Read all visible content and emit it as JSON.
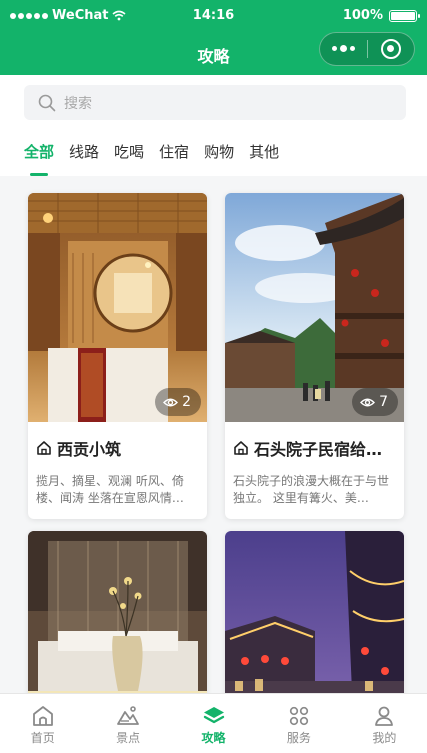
{
  "status_bar": {
    "carrier": "WeChat",
    "time": "14:16",
    "battery": "100%"
  },
  "header": {
    "title": "攻略"
  },
  "search": {
    "placeholder": "搜索"
  },
  "tabs": [
    {
      "label": "全部",
      "active": true
    },
    {
      "label": "线路",
      "active": false
    },
    {
      "label": "吃喝",
      "active": false
    },
    {
      "label": "住宿",
      "active": false
    },
    {
      "label": "购物",
      "active": false
    },
    {
      "label": "其他",
      "active": false
    }
  ],
  "cards": [
    {
      "title": "西贡小筑",
      "views": "2",
      "desc": "揽月、摘星、观澜 听风、倚楼、闻涛 坐落在宣恩风情…"
    },
    {
      "title": "石头院子民宿给…",
      "views": "7",
      "desc": "石头院子的浪漫大概在于与世独立。 这里有篝火、美…"
    },
    {
      "title": "",
      "views": "",
      "desc": ""
    },
    {
      "title": "",
      "views": "",
      "desc": ""
    }
  ],
  "bottom_nav": [
    {
      "label": "首页",
      "icon": "home-icon"
    },
    {
      "label": "景点",
      "icon": "mountain-icon"
    },
    {
      "label": "攻略",
      "icon": "layers-icon",
      "active": true
    },
    {
      "label": "服务",
      "icon": "grid-icon"
    },
    {
      "label": "我的",
      "icon": "user-icon"
    }
  ],
  "colors": {
    "brand": "#13b36a",
    "background": "#f5f6f7"
  }
}
